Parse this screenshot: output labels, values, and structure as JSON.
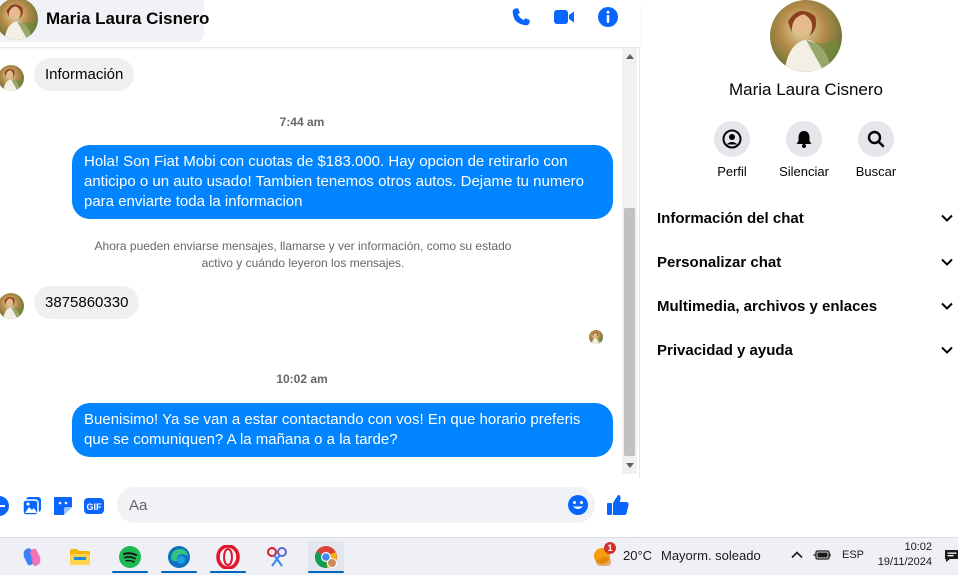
{
  "header": {
    "contact_name": "Maria Laura Cisnero",
    "icons": [
      "phone-icon",
      "video-call-icon",
      "info-icon"
    ]
  },
  "messages": {
    "incoming_1": "Información",
    "time_1": "7:44 am",
    "outgoing_1": "Hola! Son Fiat Mobi con cuotas de $183.000. Hay opcion de retirarlo con anticipo o un auto usado! Tambien tenemos otros autos. Dejame tu numero para enviarte toda la informacion",
    "system_note": "Ahora pueden enviarse mensajes, llamarse y ver información, como su estado activo y cuándo leyeron los mensajes.",
    "incoming_2": "3875860330",
    "time_2": "10:02 am",
    "outgoing_2": "Buenisimo! Ya se van a estar contactando con vos! En que horario preferis que se comuniquen? A la mañana o a la tarde?"
  },
  "composer": {
    "placeholder": "Aa",
    "value": "",
    "gif_label": "GIF"
  },
  "info_panel": {
    "name": "Maria Laura Cisnero",
    "actions": [
      {
        "label": "Perfil",
        "icon": "profile-icon"
      },
      {
        "label": "Silenciar",
        "icon": "bell-icon"
      },
      {
        "label": "Buscar",
        "icon": "search-icon"
      }
    ],
    "sections": [
      {
        "label": "Información del chat"
      },
      {
        "label": "Personalizar chat"
      },
      {
        "label": "Multimedia, archivos y enlaces"
      },
      {
        "label": "Privacidad y ayuda"
      }
    ]
  },
  "taskbar": {
    "apps": [
      "copilot-icon",
      "file-explorer-icon",
      "spotify-icon",
      "edge-icon",
      "opera-icon",
      "snipping-tool-icon",
      "chrome-icon"
    ],
    "weather_badge": "1",
    "temperature": "20°C",
    "weather": "Mayorm. soleado",
    "language": "ESP",
    "time": "10:02",
    "date": "19/11/2024"
  },
  "colors": {
    "accent": "#0084ff",
    "icon_blue": "#0866ff",
    "incoming_bubble": "#f0f0f0",
    "secondary_text": "#65676b"
  }
}
